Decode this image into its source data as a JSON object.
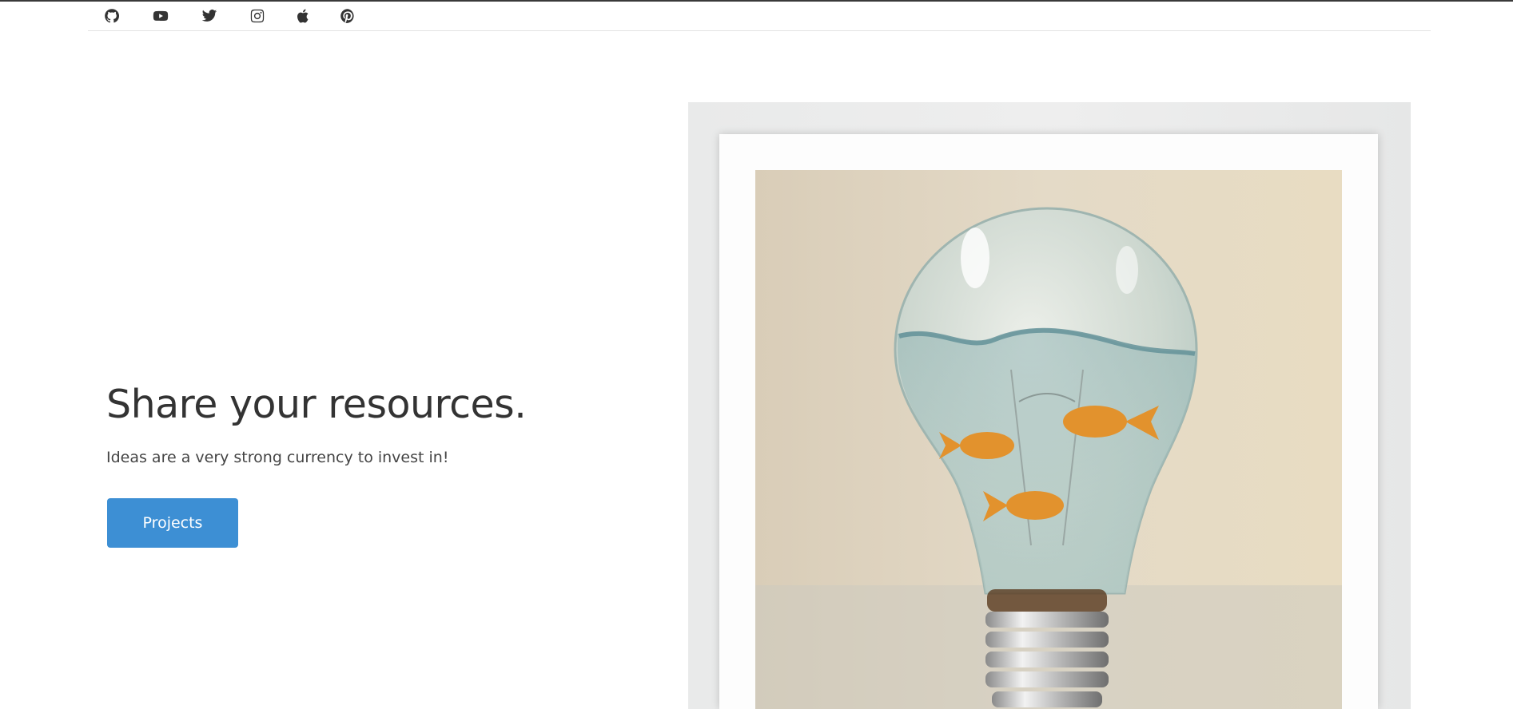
{
  "social": [
    {
      "icon": "github-icon"
    },
    {
      "icon": "youtube-icon"
    },
    {
      "icon": "twitter-icon"
    },
    {
      "icon": "instagram-icon"
    },
    {
      "icon": "apple-icon"
    },
    {
      "icon": "pinterest-icon"
    }
  ],
  "hero": {
    "title": "Share your resources.",
    "subtitle": "Ideas are a very strong currency to invest in!",
    "button_label": "Projects"
  },
  "artwork": {
    "subject": "lightbulb-fishbowl-image"
  },
  "colors": {
    "accent": "#3d8fd4",
    "text": "#333333"
  }
}
